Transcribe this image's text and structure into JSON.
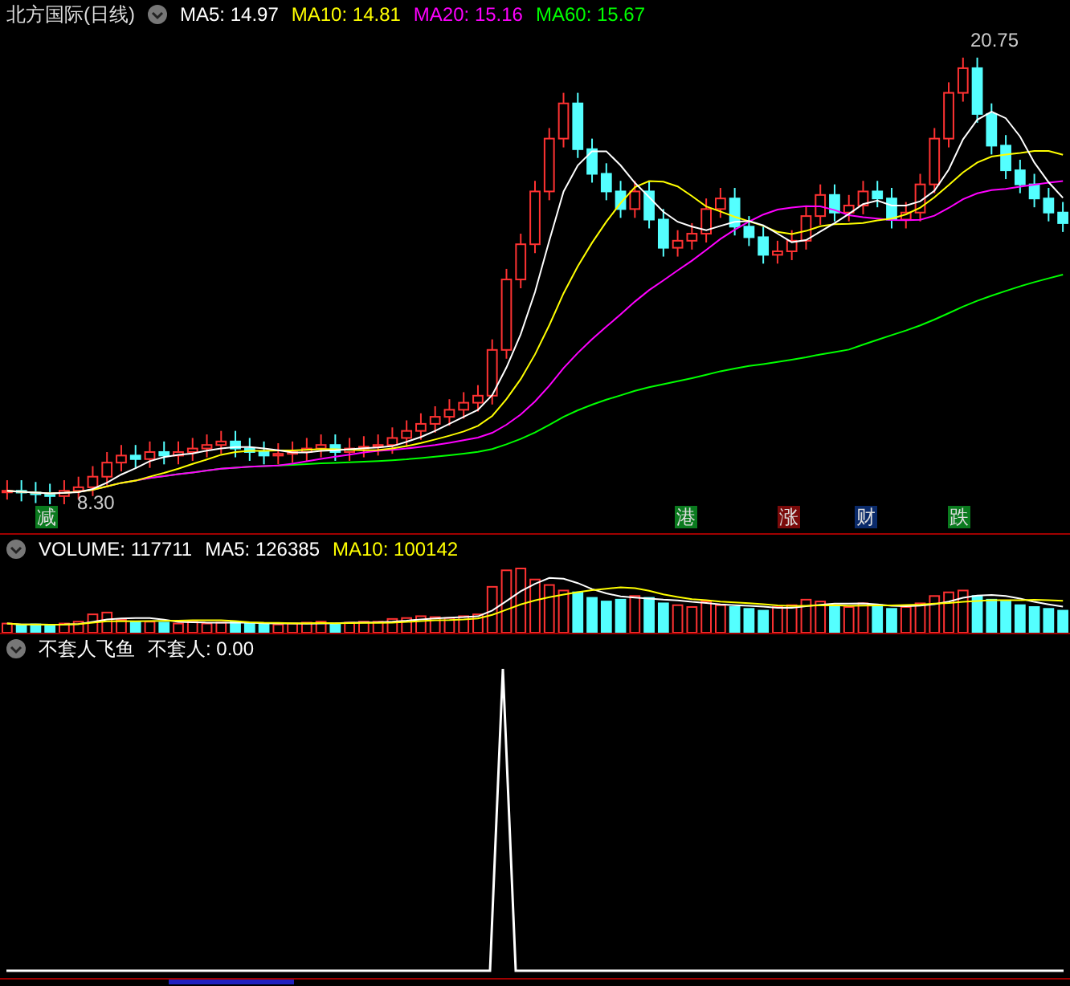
{
  "main_panel": {
    "title": "北方国际(日线)",
    "indicators": [
      {
        "label": "MA5: 14.97",
        "color": "#ffffff"
      },
      {
        "label": "MA10: 14.81",
        "color": "#ffff00"
      },
      {
        "label": "MA20: 15.16",
        "color": "#ff00ff"
      },
      {
        "label": "MA60: 15.67",
        "color": "#00ff00"
      }
    ],
    "high_label": "20.75",
    "low_label": "8.30"
  },
  "event_markers": [
    {
      "label": "减",
      "color": "#0a7a1e"
    },
    {
      "label": "港",
      "color": "#0a7a1e"
    },
    {
      "label": "涨",
      "color": "#7a0a0a"
    },
    {
      "label": "财",
      "color": "#0a2a6a"
    },
    {
      "label": "跌",
      "color": "#0a7a1e"
    }
  ],
  "volume_panel": {
    "indicators": [
      {
        "label": "VOLUME: 117711",
        "color": "#ffffff"
      },
      {
        "label": "MA5: 126385",
        "color": "#ffffff"
      },
      {
        "label": "MA10: 100142",
        "color": "#ffff00"
      }
    ]
  },
  "indicator_panel": {
    "indicators": [
      {
        "label": "不套人飞鱼",
        "color": "#ffffff"
      },
      {
        "label": "不套人: 0.00",
        "color": "#ffffff"
      }
    ]
  }
}
